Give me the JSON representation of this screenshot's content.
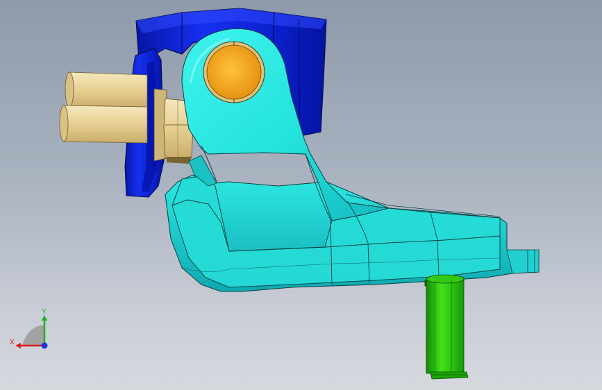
{
  "triad": {
    "x_label": "X",
    "y_label": "Y"
  },
  "colors": {
    "body": "#25e6e0",
    "body_dark": "#13b9c0",
    "bracket": "#0b1fd9",
    "bracket_dark": "#0613a0",
    "pin": "#2fcc10",
    "pin_dark": "#178a05",
    "bushing": "#f2a81a",
    "bolt": "#eedba5",
    "axis_x": "#d81b1b",
    "axis_y": "#1fb21f",
    "axis_z": "#1f35d8"
  }
}
